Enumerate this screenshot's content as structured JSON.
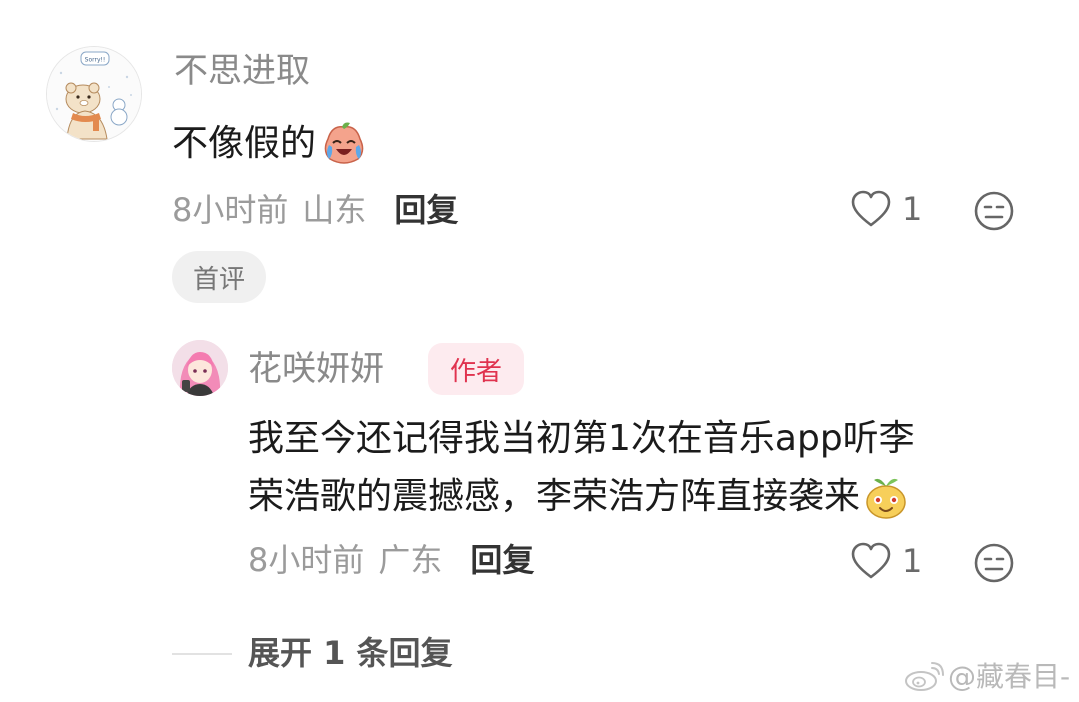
{
  "comment": {
    "username": "不思进取",
    "text": "不像假的",
    "text_emoji": "crying-laughing-peach-emoji",
    "time": "8小时前",
    "location": "山东",
    "reply_label": "回复",
    "like_count": "1",
    "badge": "首评",
    "avatar_caption": "Sorry!!"
  },
  "reply": {
    "username": "花咲妍妍",
    "author_badge": "作者",
    "text_line1": "我至今还记得我当初第1次在音乐app听李",
    "text_line2": "荣浩歌的震撼感，李荣浩方阵直接袭来",
    "text_emoji": "smiling-sprout-emoji",
    "time": "8小时前",
    "location": "广东",
    "reply_label": "回复",
    "like_count": "1"
  },
  "expand": {
    "label": "展开 1 条回复"
  },
  "watermark": {
    "text": "@藏春目-"
  },
  "colors": {
    "author_badge_text": "#e0334f",
    "author_badge_bg": "#fdebef",
    "muted_text": "#9b9b9b"
  }
}
